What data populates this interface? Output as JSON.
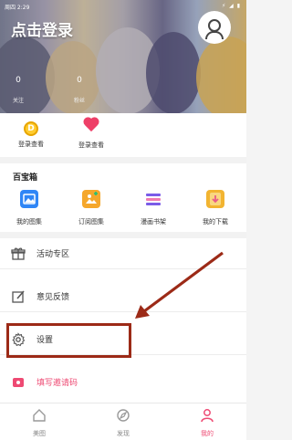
{
  "status_bar": {
    "left_text": "周四 2:29",
    "right_icons": "⚡ ◢ ▮"
  },
  "header": {
    "title": "点击登录",
    "stats": [
      {
        "value": "0",
        "label": "关注"
      },
      {
        "value": "0",
        "label": "粉丝"
      }
    ]
  },
  "quick_actions": [
    {
      "label": "登录查看",
      "icon": "coin-icon"
    },
    {
      "label": "登录查看",
      "icon": "heart-icon"
    }
  ],
  "toolbox": {
    "title": "百宝箱",
    "items": [
      {
        "label": "我的图集",
        "icon": "my-gallery-icon",
        "color": "#2f86f6"
      },
      {
        "label": "订阅图集",
        "icon": "subscribe-gallery-icon",
        "color": "#f5a72b"
      },
      {
        "label": "漫画书架",
        "icon": "bookshelf-icon",
        "color": "#7a5ce8"
      },
      {
        "label": "我的下载",
        "icon": "download-icon",
        "color": "#f2b431"
      }
    ]
  },
  "menu": {
    "items": [
      {
        "label": "活动专区",
        "icon": "gift-icon"
      },
      {
        "label": "意见反馈",
        "icon": "feedback-icon"
      },
      {
        "label": "设置",
        "icon": "settings-icon"
      }
    ],
    "invite": {
      "label": "填写邀请码",
      "icon": "invite-icon",
      "color": "#ee4a73"
    }
  },
  "tabbar": {
    "tabs": [
      {
        "label": "美图",
        "icon": "home-icon",
        "active": false
      },
      {
        "label": "发现",
        "icon": "discover-icon",
        "active": false
      },
      {
        "label": "我的",
        "icon": "profile-icon",
        "active": true
      }
    ]
  },
  "colors": {
    "accent": "#ee4a73",
    "annotation": "#9c2a17"
  }
}
